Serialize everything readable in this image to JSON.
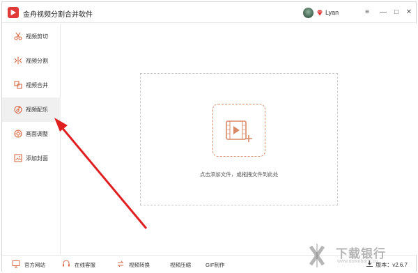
{
  "app": {
    "title": "金舟视频分割合并软件",
    "username": "Lyan",
    "accent": "#e03a3a",
    "upload_color": "#d88a65"
  },
  "window_controls": {
    "menu": "≡",
    "minimize": "—",
    "maximize": "□",
    "close": "✕"
  },
  "sidebar": {
    "items": [
      {
        "label": "视频剪切",
        "icon": "scissors-icon",
        "active": false
      },
      {
        "label": "视频分割",
        "icon": "split-icon",
        "active": false
      },
      {
        "label": "视频合并",
        "icon": "merge-icon",
        "active": false
      },
      {
        "label": "视频配乐",
        "icon": "music-icon",
        "active": true
      },
      {
        "label": "画面调整",
        "icon": "adjust-icon",
        "active": false
      },
      {
        "label": "添加封面",
        "icon": "image-icon",
        "active": false
      }
    ]
  },
  "main": {
    "drop_hint": "点击添加文件，或拖拽文件到此处"
  },
  "bottombar": {
    "items": [
      {
        "label": "官方网站",
        "icon": "monitor-icon"
      },
      {
        "label": "在线客服",
        "icon": "headset-icon"
      },
      {
        "label": "视频转换",
        "icon": "convert-icon"
      },
      {
        "label": "视频压缩",
        "icon": ""
      },
      {
        "label": "GIF制作",
        "icon": ""
      }
    ],
    "version": "版本：v2.6.7"
  },
  "watermark": {
    "text": "下载银行",
    "sub": "www.downbank.cn"
  }
}
